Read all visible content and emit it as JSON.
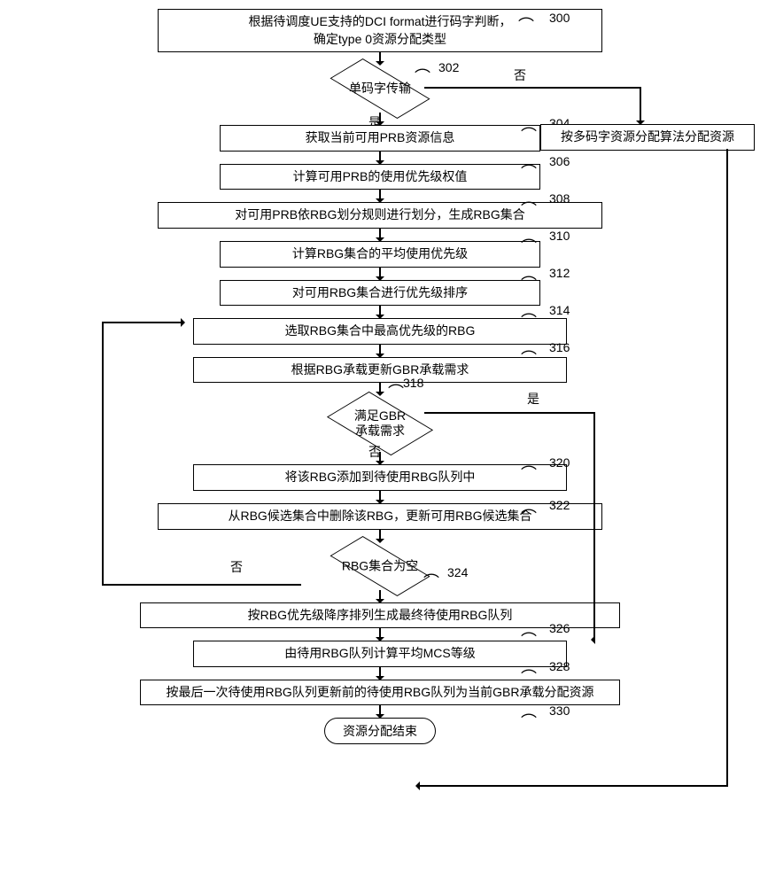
{
  "steps": {
    "s300": "根据待调度UE支持的DCI format进行码字判断，\n确定type 0资源分配类型",
    "d302": "单码字传输",
    "s304": "获取当前可用PRB资源信息",
    "s306": "计算可用PRB的使用优先级权值",
    "s308": "对可用PRB依RBG划分规则进行划分，生成RBG集合",
    "s310": "计算RBG集合的平均使用优先级",
    "s312": "对可用RBG集合进行优先级排序",
    "s314": "选取RBG集合中最高优先级的RBG",
    "s316": "根据RBG承载更新GBR承载需求",
    "d318": "满足GBR\n承载需求",
    "s320": "将该RBG添加到待使用RBG队列中",
    "s322": "从RBG候选集合中删除该RBG，更新可用RBG候选集合",
    "d324": "RBG集合为空",
    "s326": "按RBG优先级降序排列生成最终待使用RBG队列",
    "s328": "由待用RBG队列计算平均MCS等级",
    "s330": "按最后一次待使用RBG队列更新前的待使用RBG队列为当前GBR承载分配资源",
    "multi": "按多码字资源分配算法分配资源",
    "end": "资源分配结束"
  },
  "labels": {
    "yes": "是",
    "no": "否"
  },
  "refs": {
    "r300": "300",
    "r302": "302",
    "r304": "304",
    "r306": "306",
    "r308": "308",
    "r310": "310",
    "r312": "312",
    "r314": "314",
    "r316": "316",
    "r318": "318",
    "r320": "320",
    "r322": "322",
    "r324": "324",
    "r326": "326",
    "r328": "328",
    "r330": "330"
  }
}
